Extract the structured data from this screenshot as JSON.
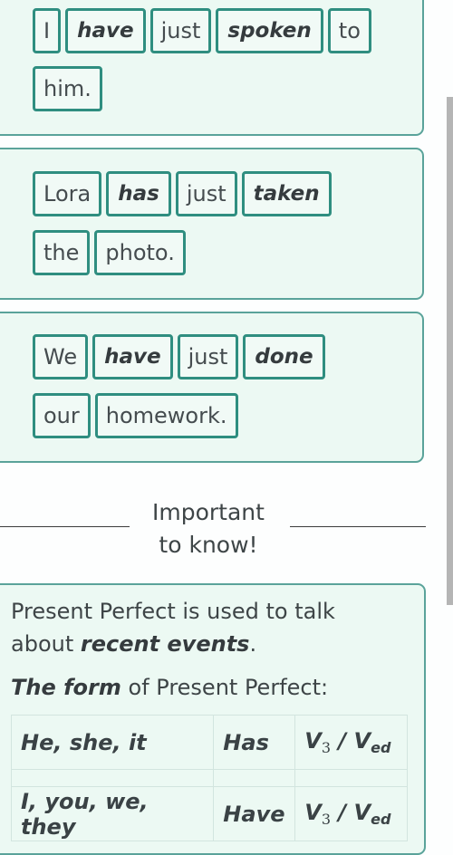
{
  "sentences": [
    {
      "lines": [
        [
          {
            "text": "I",
            "emphasis": false
          },
          {
            "text": "have",
            "emphasis": true
          },
          {
            "text": "just",
            "emphasis": false
          },
          {
            "text": "spoken",
            "emphasis": true
          },
          {
            "text": "to",
            "emphasis": false
          }
        ],
        [
          {
            "text": "him.",
            "emphasis": false
          }
        ]
      ]
    },
    {
      "lines": [
        [
          {
            "text": "Lora",
            "emphasis": false
          },
          {
            "text": "has",
            "emphasis": true
          },
          {
            "text": "just",
            "emphasis": false
          },
          {
            "text": "taken",
            "emphasis": true
          }
        ],
        [
          {
            "text": "the",
            "emphasis": false
          },
          {
            "text": "photo.",
            "emphasis": false
          }
        ]
      ]
    },
    {
      "lines": [
        [
          {
            "text": "We",
            "emphasis": false
          },
          {
            "text": "have",
            "emphasis": true
          },
          {
            "text": "just",
            "emphasis": false
          },
          {
            "text": "done",
            "emphasis": true
          }
        ],
        [
          {
            "text": "our",
            "emphasis": false
          },
          {
            "text": "homework.",
            "emphasis": false
          }
        ]
      ]
    }
  ],
  "important": {
    "line1": "Important",
    "line2": "to know!"
  },
  "info": {
    "usage_prefix": "Present Perfect is used to talk about ",
    "usage_emphasis": "recent events",
    "usage_suffix": ".",
    "form_emphasis": "The form",
    "form_suffix": " of Present Perfect:",
    "table": [
      {
        "subject": "He, she, it",
        "auxiliary": "Has",
        "verb_base": "V",
        "verb_sub1": "3",
        "sep": " / ",
        "verb_base2": "V",
        "verb_sub2": "ed"
      },
      {
        "subject": "I, you, we, they",
        "auxiliary": "Have",
        "verb_base": "V",
        "verb_sub1": "3",
        "sep": " / ",
        "verb_base2": "V",
        "verb_sub2": "ed"
      }
    ]
  },
  "colors": {
    "accent": "#2f8e80",
    "card_bg": "#ecf9f3",
    "card_border": "#5aa39a",
    "text": "#3e4547"
  }
}
